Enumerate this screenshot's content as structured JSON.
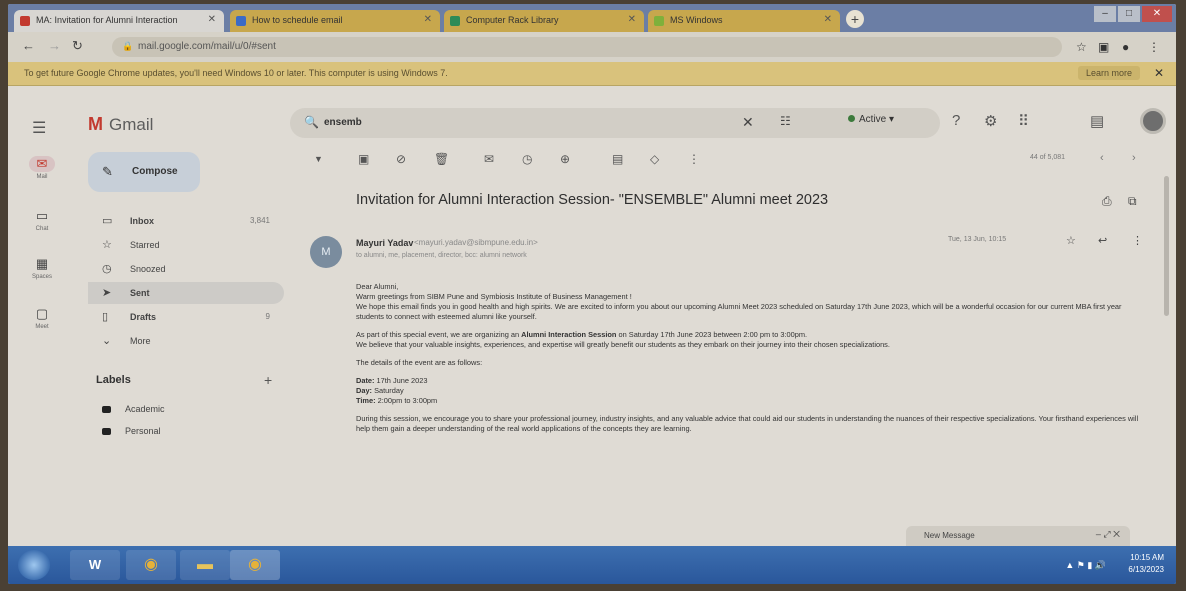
{
  "browser": {
    "tabs": [
      {
        "label": "MA: Invitation for Alumni Interaction",
        "state": "active"
      },
      {
        "label": "How to schedule email",
        "state": "inactive"
      },
      {
        "label": "Computer Rack Library",
        "state": "inactive"
      },
      {
        "label": "MS Windows",
        "state": "inactive"
      }
    ],
    "url": "mail.google.com/mail/u/0/#sent",
    "infobar_message": "To get future Google Chrome updates, you'll need Windows 10 or later. This computer is using Windows 7.",
    "infobar_button": "Learn more"
  },
  "gmail": {
    "product_name": "Gmail",
    "search_value": "ensemb",
    "status": "Active",
    "compose_label": "Compose",
    "rail": [
      {
        "label": "Mail",
        "icon": "mail-icon"
      },
      {
        "label": "Chat",
        "icon": "chat-icon"
      },
      {
        "label": "Spaces",
        "icon": "spaces-icon"
      },
      {
        "label": "Meet",
        "icon": "meet-icon"
      }
    ],
    "folders": [
      {
        "label": "Inbox",
        "count": "3,841",
        "icon": "inbox-icon"
      },
      {
        "label": "Starred",
        "count": "",
        "icon": "star-icon"
      },
      {
        "label": "Snoozed",
        "count": "",
        "icon": "clock-icon"
      },
      {
        "label": "Sent",
        "count": "",
        "icon": "send-icon"
      },
      {
        "label": "Drafts",
        "count": "9",
        "icon": "draft-icon"
      },
      {
        "label": "More",
        "count": "",
        "icon": "chevron-down-icon"
      }
    ],
    "labels_title": "Labels",
    "labels": [
      "Academic",
      "Personal"
    ],
    "pagination": "44 of 5,081"
  },
  "message": {
    "subject": "Invitation for Alumni Interaction Session- \"ENSEMBLE\" Alumni meet 2023",
    "sender_initials": "M",
    "sender_name": "Mayuri Yadav",
    "sender_email": "<mayuri.yadav@sibmpune.edu.in>",
    "to_line": "to alumni, me, placement, director, bcc: alumni network",
    "time": "Tue, 13 Jun, 10:15",
    "greeting": "Dear Alumni,",
    "p1": "Warm greetings from SIBM Pune and Symbiosis Institute of Business Management !",
    "p2": "We hope this email finds you in good health and high spirits. We are excited to inform you about our upcoming Alumni Meet 2023 scheduled on Saturday 17th June 2023, which will be a wonderful occasion for our current MBA first year students to connect with esteemed alumni like yourself.",
    "p3_pre": "As part of this special event, we are organizing an ",
    "p3_bold": "Alumni Interaction Session",
    "p3_post": " on Saturday 17th June 2023 between 2:00 pm to 3:00pm.",
    "p4": "We believe that your valuable insights, experiences, and expertise will greatly benefit our students as they embark on their journey into their chosen specializations.",
    "p5": "The details of the event are as follows:",
    "date_label": "Date:",
    "date_value": " 17th June 2023",
    "day_label": "Day:",
    "day_value": " Saturday",
    "time_label": "Time:",
    "time_value": " 2:00pm to 3:00pm",
    "p6": "During this session, we encourage you to share your professional journey, industry insights, and any valuable advice that could aid our students in understanding the nuances of their respective specializations. Your firsthand experiences will help them gain a deeper understanding of the real world applications of the concepts they are learning."
  },
  "dock": {
    "new_message": "New Message"
  },
  "taskbar": {
    "apps": [
      "word-icon",
      "chrome-icon",
      "explorer-icon",
      "chrome-icon"
    ],
    "clock_time": "10:15 AM",
    "clock_date": "6/13/2023"
  }
}
